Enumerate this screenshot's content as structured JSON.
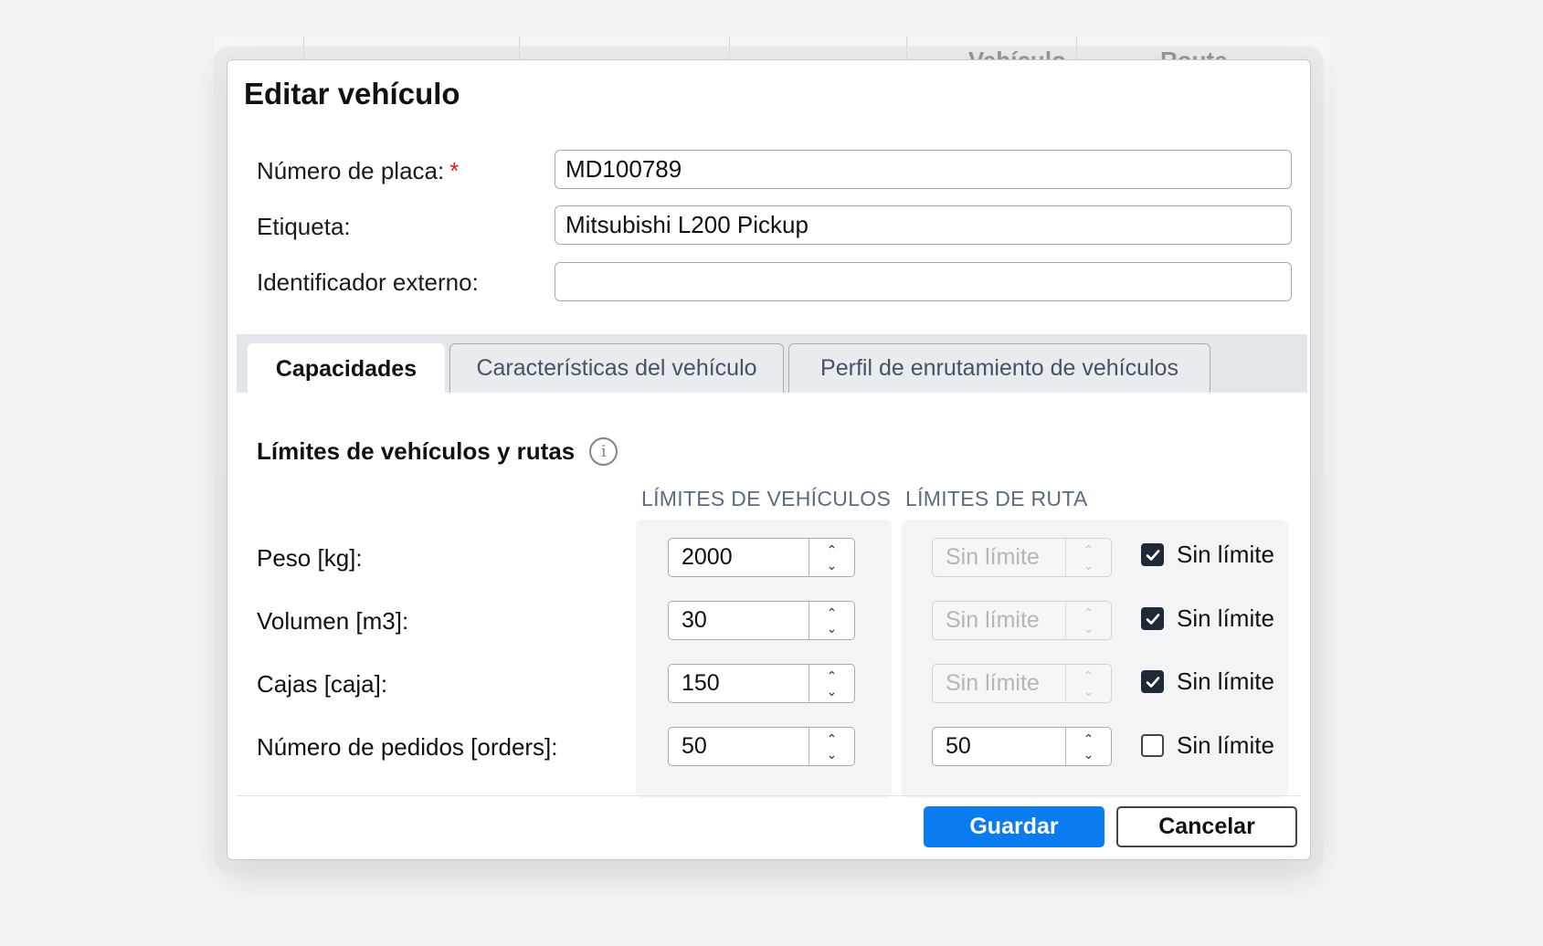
{
  "background": {
    "col_headers": [
      "Vehículo",
      "Route"
    ]
  },
  "dialog": {
    "title": "Editar vehículo",
    "fields": {
      "plate": {
        "label": "Número de placa:",
        "required_mark": "*",
        "value": "MD100789"
      },
      "tag": {
        "label": "Etiqueta:",
        "value": "Mitsubishi L200 Pickup"
      },
      "external_id": {
        "label": "Identificador externo:",
        "value": ""
      }
    },
    "tabs": [
      {
        "label": "Capacidades",
        "active": true
      },
      {
        "label": "Características del vehículo",
        "active": false
      },
      {
        "label": "Perfil de enrutamiento de vehículos",
        "active": false
      }
    ],
    "limits": {
      "section_title": "Límites de vehículos y rutas",
      "info_icon": "info-icon",
      "vehicle_header": "LÍMITES DE VEHÍCULOS",
      "route_header": "LÍMITES DE RUTA",
      "rows": [
        {
          "label": "Peso [kg]:",
          "vehicle_value": "2000",
          "route_value": "Sin límite",
          "unlimited": true,
          "check_label": "Sin límite"
        },
        {
          "label": "Volumen [m3]:",
          "vehicle_value": "30",
          "route_value": "Sin límite",
          "unlimited": true,
          "check_label": "Sin límite"
        },
        {
          "label": "Cajas [caja]:",
          "vehicle_value": "150",
          "route_value": "Sin límite",
          "unlimited": true,
          "check_label": "Sin límite"
        },
        {
          "label": "Número de pedidos [orders]:",
          "vehicle_value": "50",
          "route_value": "50",
          "unlimited": false,
          "check_label": "Sin límite"
        }
      ]
    },
    "buttons": {
      "save": "Guardar",
      "cancel": "Cancelar"
    }
  },
  "colors": {
    "primary": "#0a7cf0",
    "required": "#d21f1f",
    "header_text": "#5b6b80"
  }
}
